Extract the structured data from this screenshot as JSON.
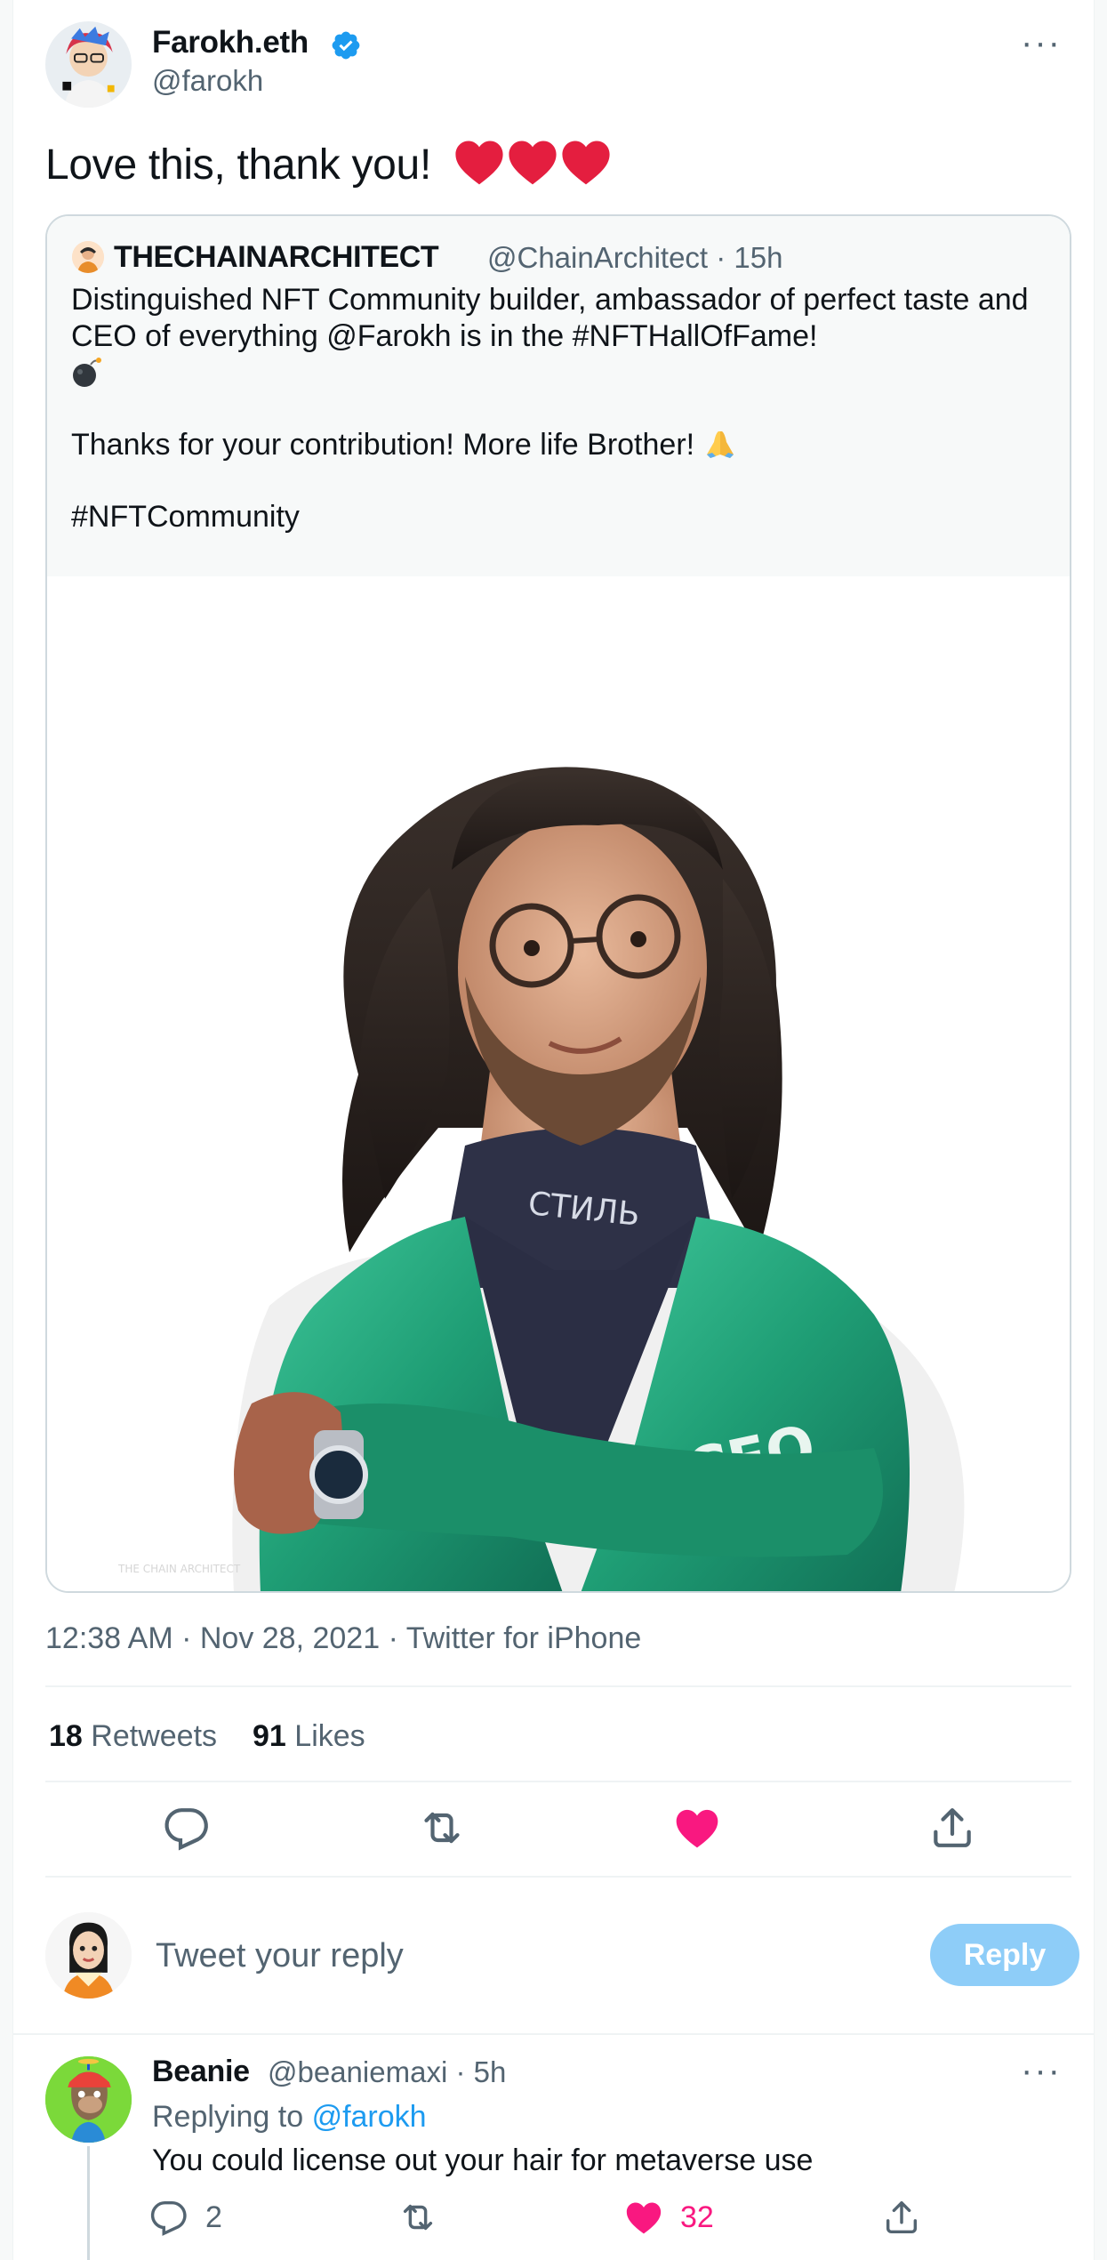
{
  "author": {
    "name": "Farokh.eth",
    "handle": "@farokh",
    "more_icon": "more-horizontal-icon"
  },
  "tweet": {
    "text": "Love this, thank you!",
    "emoji": "red-heart-icon x3"
  },
  "quote": {
    "name": "THECHAINARCHITECT",
    "handle_time": "@ChainArchitect · 15h",
    "body_line1": "Distinguished NFT Community builder, ambassador of perfect taste and CEO of everything @Farokh is in the #NFTHallOfFame!",
    "body_line2": "Thanks for your contribution! More life Brother!",
    "body_line3": "#NFTCommunity",
    "image_text_neck": "СТИЛЬ",
    "image_text_chest": "CEO",
    "image_watermark": "THE CHAIN ARCHITECT"
  },
  "meta": "12:38 AM · Nov 28, 2021 · Twitter for iPhone",
  "stats": {
    "retweets_count": "18",
    "retweets_label": "Retweets",
    "likes_count": "91",
    "likes_label": "Likes"
  },
  "composer": {
    "placeholder": "Tweet your reply",
    "reply_label": "Reply"
  },
  "reply": {
    "name": "Beanie",
    "handle_time": "@beaniemaxi · 5h",
    "replying_prefix": "Replying to",
    "replying_mention": "@farokh",
    "text": "You could license out your hair for metaverse use",
    "replies": "2",
    "likes": "32"
  },
  "colors": {
    "accent": "#1d9bf0",
    "like": "#f91880",
    "secondary_text": "#536471",
    "reply_button_disabled": "#8ecdf8"
  }
}
